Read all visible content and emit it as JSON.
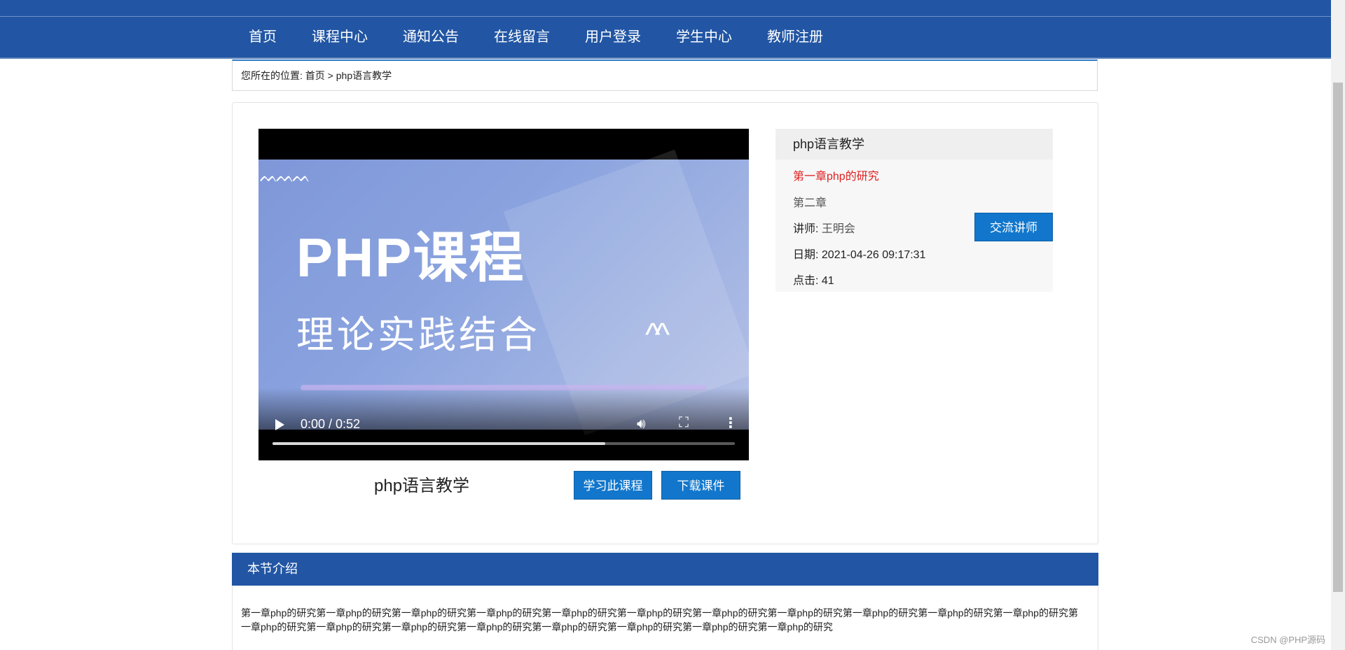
{
  "nav": {
    "items": [
      "首页",
      "课程中心",
      "通知公告",
      "在线留言",
      "用户登录",
      "学生中心",
      "教师注册"
    ]
  },
  "breadcrumb": {
    "prefix": "您所在的位置:",
    "home": "首页",
    "separator": ">",
    "current": "php语言教学"
  },
  "video": {
    "poster_title": "PHP课程",
    "poster_subtitle": "理论实践结合",
    "time": "0:00 / 0:52",
    "buffered_fraction": 0.72,
    "icons": {
      "play": "play-icon",
      "volume": "volume-icon",
      "fullscreen": "fullscreen-icon",
      "more": "more-vertical-icon"
    }
  },
  "course": {
    "title": "php语言教学",
    "study_label": "学习此课程",
    "download_label": "下载课件"
  },
  "info": {
    "title": "php语言教学",
    "chapter_active": "第一章php的研究",
    "chapter_2": "第二章",
    "teacher_label": "讲师:",
    "teacher_name": "王明会",
    "date_label": "日期:",
    "date_value": "2021-04-26 09:17:31",
    "clicks_label": "点击:",
    "clicks_value": "41",
    "contact_label": "交流讲师"
  },
  "intro": {
    "heading": "本节介绍",
    "text": "第一章php的研究第一章php的研究第一章php的研究第一章php的研究第一章php的研究第一章php的研究第一章php的研究第一章php的研究第一章php的研究第一章php的研究第一章php的研究第一章php的研究第一章php的研究第一章php的研究第一章php的研究第一章php的研究第一章php的研究第一章php的研究第一章php的研究"
  },
  "watermark": "CSDN @PHP源码",
  "colors": {
    "brand_blue": "#2256a4",
    "button_blue": "#1277cc",
    "active_red": "#e02020"
  }
}
